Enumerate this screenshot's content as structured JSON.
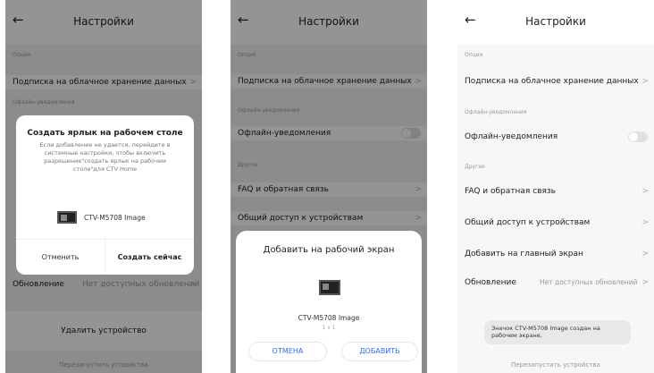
{
  "header": {
    "title": "Настройки"
  },
  "sections": {
    "option": "Опция",
    "offline": "Офлайн-уведомления",
    "other": "Другие"
  },
  "rows": {
    "subscription": "Подписка на облачное хранение данных",
    "offline_notifications": "Офлайн-уведомления",
    "faq": "FAQ и обратная связь",
    "sharing": "Общий доступ к устройствам",
    "add_home": "Добавить на главный экран",
    "update": "Обновление",
    "update_value": "Нет доступных обновлений",
    "delete_device": "Удалить устройство",
    "restart_device": "Перезапустить устройства"
  },
  "chevron": ">",
  "back": "←",
  "dialog1": {
    "title": "Создать ярлык на рабочем столе",
    "message": "Если добавление не удается, перейдите в системные настройки, чтобы включить разрешение\"создать ярлык на рабочем столе\"для CTV Home",
    "device_name": "CTV-M5708 Image",
    "cancel": "Отменить",
    "confirm": "Создать сейчас"
  },
  "sheet2": {
    "title": "Добавить на рабочий экран",
    "device_name": "CTV-M5708 Image",
    "size": "1 x 1",
    "cancel": "ОТМЕНА",
    "add": "ДОБАВИТЬ"
  },
  "toast3": {
    "text": "Значок CTV-M5708 Image создан на рабочем экране."
  },
  "colors": {
    "accent": "#2b6ef5",
    "text": "#222222",
    "secondary": "#999999"
  },
  "icons": {
    "back": "arrow-left-icon",
    "chevron": "chevron-right-icon",
    "device": "device-thumbnail-icon"
  }
}
